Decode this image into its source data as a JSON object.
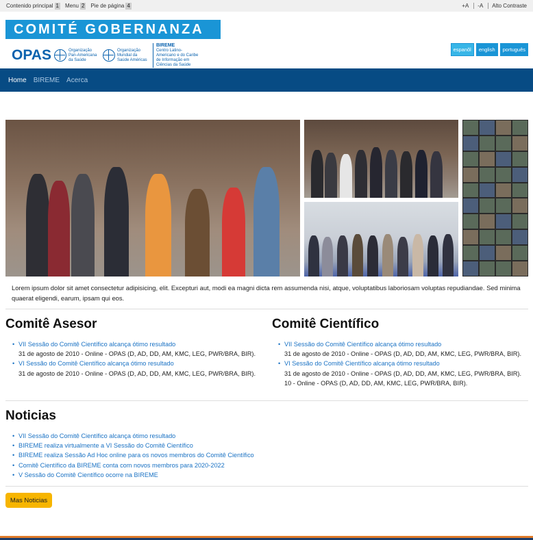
{
  "accessibility": {
    "skip_links": [
      {
        "label": "Contenido principal",
        "key": "1"
      },
      {
        "label": "Menu",
        "key": "2"
      },
      {
        "label": "Pie de página",
        "key": "4"
      }
    ],
    "increase_font": "+A",
    "decrease_font": "-A",
    "high_contrast": "Alto Contraste"
  },
  "header": {
    "brand_title": "COMITÉ GOBERNANZA",
    "logo_opas": "OPAS",
    "org1": "Organização Pan-Americana da Saúde",
    "org2": "Organização Mundial da Saúde Américas",
    "bireme_name": "BIREME",
    "bireme_desc": "Centro Latino-Americano e do Caribe de Informação em Ciências da Saúde",
    "languages": [
      {
        "label": "espanõl",
        "active": true
      },
      {
        "label": "english",
        "active": false
      },
      {
        "label": "português",
        "active": false
      }
    ]
  },
  "nav": {
    "items": [
      {
        "label": "Home",
        "active": true
      },
      {
        "label": "BIREME",
        "active": false
      },
      {
        "label": "Acerca",
        "active": false
      }
    ]
  },
  "intro": "Lorem ipsum dolor sit amet consectetur adipisicing, elit. Excepturi aut, modi ea magni dicta rem assumenda nisi, atque, voluptatibus laboriosam voluptas repudiandae. Sed minima quaerat eligendi, earum, ipsam qui eos.",
  "asesor": {
    "title": "Comitê Asesor",
    "items": [
      {
        "link": "VII Sessão do Comitê Científico alcança ótimo resultado",
        "meta": "31 de agosto de 2010 - Online - OPAS (D, AD, DD, AM, KMC, LEG, PWR/BRA, BIR)."
      },
      {
        "link": "VI Sessão do Comitê Científico alcança ótimo resultado",
        "meta": "31 de agosto de 2010 - Online - OPAS (D, AD, DD, AM, KMC, LEG, PWR/BRA, BIR)."
      }
    ]
  },
  "cientifico": {
    "title": "Comitê Científico",
    "items": [
      {
        "link": "VII Sessão do Comitê Científico alcança ótimo resultado",
        "meta": "31 de agosto de 2010 - Online - OPAS (D, AD, DD, AM, KMC, LEG, PWR/BRA, BIR)."
      },
      {
        "link": "VI Sessão do Comitê Científico alcança ótimo resultado",
        "meta": "31 de agosto de 2010 - Online - OPAS (D, AD, DD, AM, KMC, LEG, PWR/BRA, BIR).",
        "meta2": "10 - Online - OPAS (D, AD, DD, AM, KMC, LEG, PWR/BRA, BIR)."
      }
    ]
  },
  "news": {
    "title": "Noticias",
    "items": [
      "VII Sessão do Comitê Científico alcança ótimo resultado",
      "BIREME realiza virtualmente a VI Sessão do Comitê Científico",
      "BIREME realiza Sessão Ad Hoc online para os novos membros do Comitê Científico",
      "Comitê Científico da BIREME conta com novos membros para 2020-2022",
      "V Sessão do Comitê Científico ocorre na BIREME"
    ],
    "more_button": "Mas Noticias"
  },
  "colors": {
    "brand_blue": "#1a95d6",
    "nav_blue": "#074b84",
    "link_blue": "#1a72c4",
    "button_yellow": "#f7b500",
    "footer_orange": "#e07b2a"
  }
}
